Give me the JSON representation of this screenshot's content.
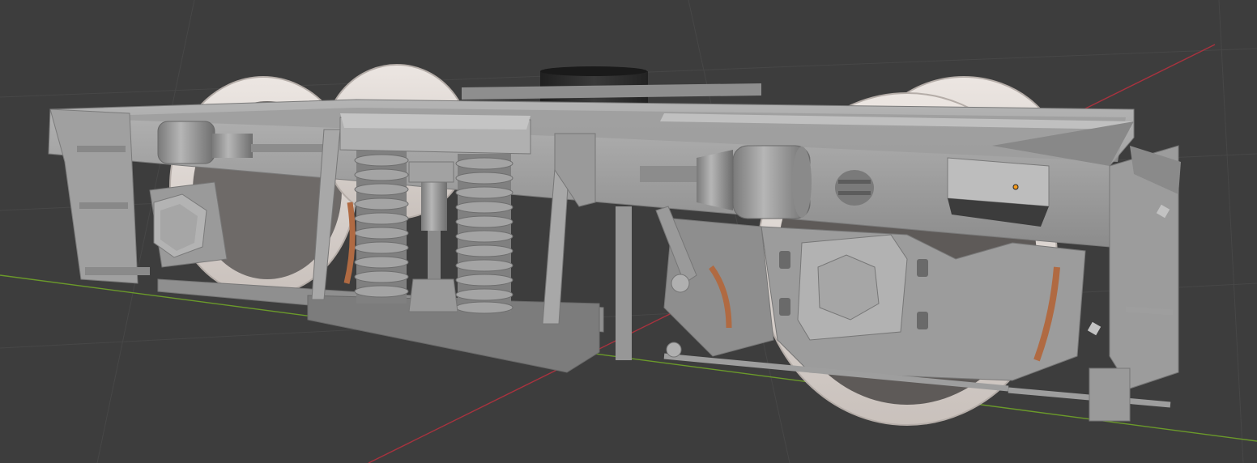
{
  "viewport": {
    "background": "#3d3d3d",
    "grid_color": "#474747",
    "x_axis_color": "#a8323e",
    "y_axis_color": "#6b9a2a",
    "origin_color": "#f59a1b"
  },
  "model": {
    "frame_color": "#a4a4a4",
    "wheel_color": "#e3dcd8",
    "brake_color": "#b06a42",
    "damper_color": "#2a2a2a"
  }
}
